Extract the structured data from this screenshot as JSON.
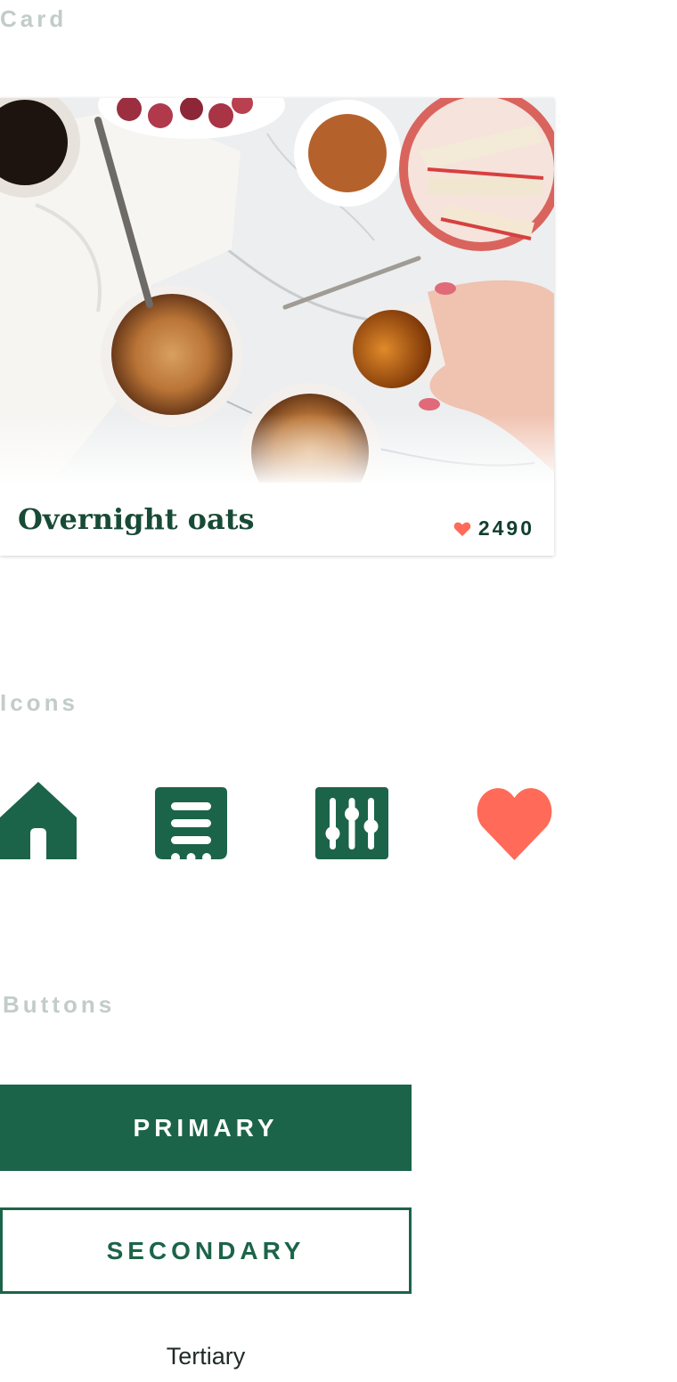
{
  "sections": {
    "card_label": "Card",
    "icons_label": "Icons",
    "buttons_label": "Buttons"
  },
  "card": {
    "title": "Overnight oats",
    "likes": "2490"
  },
  "icons": [
    "home-icon",
    "list-icon",
    "sliders-icon",
    "heart-icon"
  ],
  "buttons": {
    "primary": "PRIMARY",
    "secondary": "SECONDARY",
    "tertiary": "Tertiary"
  },
  "colors": {
    "brand_green": "#1c6449",
    "heart_red": "#ff6a59",
    "section_label_gray": "#c2ccc8",
    "title_green": "#184b37"
  }
}
